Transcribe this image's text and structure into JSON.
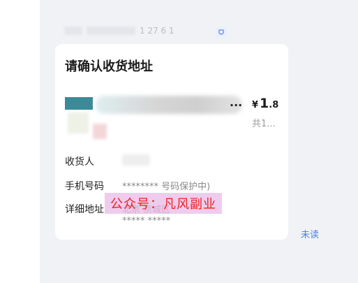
{
  "chat": {
    "sender_time_masked": "1 27 6 1"
  },
  "card": {
    "title": "请确认收货地址",
    "product": {
      "ellipsis": "...",
      "price_symbol": "¥",
      "price_int": "1",
      "price_dec": ".8",
      "quantity": "共1..."
    },
    "receiver_label": "收货人",
    "phone_label": "手机号码",
    "phone_value": "******** 号码保护中)",
    "address_label": "详细地址",
    "address_line1": "北京 京城区",
    "address_line2": "*****  *****"
  },
  "watermark": "公众号：凡风副业",
  "status": {
    "unread": "未读"
  },
  "colors": {
    "chat_bg": "#f1f2f6",
    "link_blue": "#4b84e0",
    "watermark_text": "#f02020"
  },
  "icons": {
    "mask": "privacy-mask-icon"
  }
}
